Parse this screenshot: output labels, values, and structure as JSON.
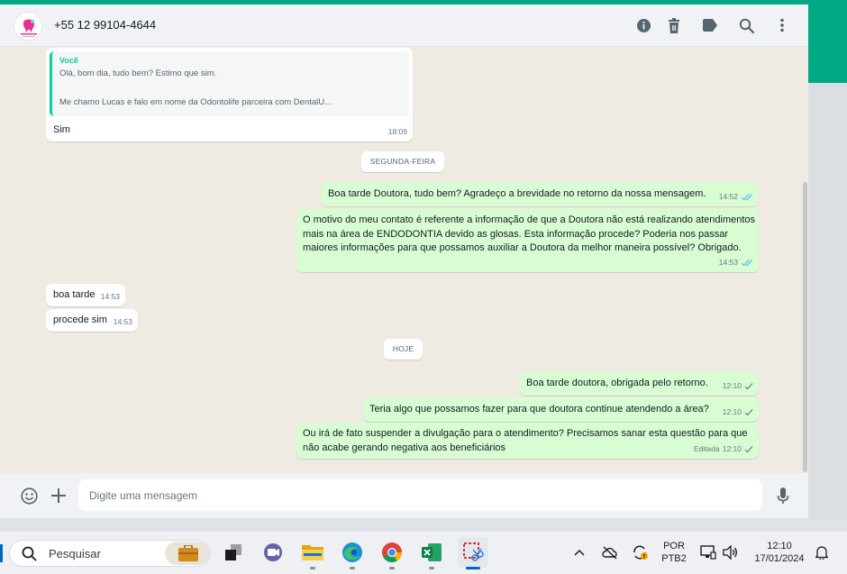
{
  "colors": {
    "accent": "#00a884",
    "outgoing": "#d9fdd3",
    "incoming": "#ffffff",
    "tick_read": "#53bdeb",
    "tick_sent": "#667781",
    "chat_bg": "#efeae2"
  },
  "header": {
    "contact": "+55 12 99104-4644",
    "avatar_icon": "contact-logo",
    "icons": [
      "info-icon",
      "delete-icon",
      "label-icon",
      "search-icon",
      "menu-icon"
    ]
  },
  "messages": {
    "m1": {
      "direction": "incoming",
      "quote_author": "Você",
      "quote_text": "Olá, bom dia, tudo bem? Estimo que sim.\n\nMe chamo Lucas e falo em nome da Odontolife parceira com DentalU...",
      "text": "Sim",
      "time": "18:09"
    },
    "d1": "SEGUNDA-FEIRA",
    "m2": {
      "direction": "outgoing",
      "text": "Boa tarde Doutora, tudo bem? Agradeço a brevidade no retorno da nossa mensagem.",
      "time": "14:52",
      "status": "read"
    },
    "m3": {
      "direction": "outgoing",
      "text": "O motivo do meu contato é referente a informação de que a Doutora não está realizando atendimentos mais na área de ENDODONTIA devido as glosas. Esta informação procede? Poderia nos passar maiores informações para que possamos auxiliar a Doutora da melhor maneira possível? Obrigado.",
      "time": "14:53",
      "status": "read"
    },
    "m4": {
      "direction": "incoming",
      "text": "boa tarde",
      "time": "14:53"
    },
    "m5": {
      "direction": "incoming",
      "text": "procede sim",
      "time": "14:53"
    },
    "d2": "HOJE",
    "m6": {
      "direction": "outgoing",
      "text": "Boa tarde doutora, obrigada pelo retorno.",
      "time": "12:10",
      "status": "sent"
    },
    "m7": {
      "direction": "outgoing",
      "text": "Teria algo que possamos fazer para que doutora continue atendendo a área?",
      "time": "12:10",
      "status": "sent"
    },
    "m8": {
      "direction": "outgoing",
      "text": "Ou irá de fato suspender a divulgação para o atendimento? Precisamos sanar esta questão para que não acabe gerando negativa aos beneficiários",
      "edited_label": "Editada",
      "time": "12:10",
      "status": "sent"
    }
  },
  "composer": {
    "placeholder": "Digite uma mensagem",
    "icons": [
      "emoji-icon",
      "attach-plus-icon",
      "microphone-icon"
    ]
  },
  "taskbar": {
    "search_label": "Pesquisar",
    "apps": [
      "work-briefcase-icon",
      "task-view-icon",
      "teams-icon",
      "file-explorer-icon",
      "edge-icon",
      "chrome-icon",
      "excel-icon",
      "snipping-tool-icon"
    ],
    "language_line1": "POR",
    "language_line2": "PTB2",
    "time": "12:10",
    "date": "17/01/2024"
  }
}
